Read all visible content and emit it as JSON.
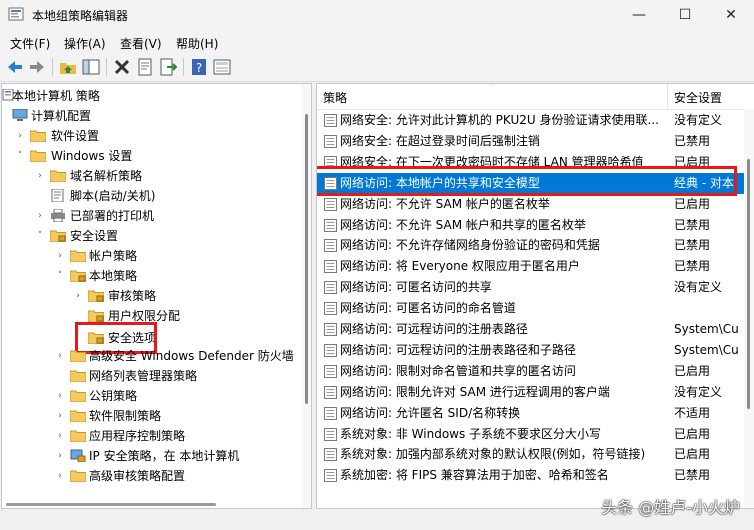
{
  "window": {
    "title": "本地组策略编辑器",
    "controls": {
      "minimize": "—",
      "maximize": "☐",
      "close": "✕"
    }
  },
  "menu": [
    "文件(F)",
    "操作(A)",
    "查看(V)",
    "帮助(H)"
  ],
  "toolbar": {
    "icons": [
      "back-icon",
      "forward-icon",
      "up-folder-icon",
      "show-hide-tree-icon",
      "delete-icon",
      "properties-icon",
      "export-list-icon",
      "help-icon",
      "view-icon"
    ]
  },
  "tree": {
    "root": "本地计算机 策略",
    "items": [
      {
        "label": "计算机配置",
        "expander": ""
      },
      {
        "label": "软件设置",
        "expander": "›"
      },
      {
        "label": "Windows 设置",
        "expander": "˅"
      },
      {
        "label": "域名解析策略",
        "expander": "›"
      },
      {
        "label": "脚本(启动/关机)",
        "expander": ""
      },
      {
        "label": "已部署的打印机",
        "expander": "›"
      },
      {
        "label": "安全设置",
        "expander": "˅"
      },
      {
        "label": "帐户策略",
        "expander": "›"
      },
      {
        "label": "本地策略",
        "expander": "˅"
      },
      {
        "label": "审核策略",
        "expander": "›"
      },
      {
        "label": "用户权限分配",
        "expander": ""
      },
      {
        "label": "安全选项",
        "expander": ""
      },
      {
        "label": "高级安全 Windows Defender 防火墙",
        "expander": "›"
      },
      {
        "label": "网络列表管理器策略",
        "expander": ""
      },
      {
        "label": "公钥策略",
        "expander": "›"
      },
      {
        "label": "软件限制策略",
        "expander": "›"
      },
      {
        "label": "应用程序控制策略",
        "expander": "›"
      },
      {
        "label": "IP 安全策略，在 本地计算机",
        "expander": "›"
      },
      {
        "label": "高级审核策略配置",
        "expander": "›"
      }
    ]
  },
  "list": {
    "columns": {
      "policy": "策略",
      "setting": "安全设置"
    },
    "rows": [
      {
        "name": "网络安全: 允许对此计算机的 PKU2U 身份验证请求使用联...",
        "setting": "没有定义"
      },
      {
        "name": "网络安全: 在超过登录时间后强制注销",
        "setting": "已禁用"
      },
      {
        "name": "网络安全: 在下一次更改密码时不存储 LAN 管理器哈希值",
        "setting": "已启用"
      },
      {
        "name": "网络访问: 本地帐户的共享和安全模型",
        "setting": "经典 - 对本"
      },
      {
        "name": "网络访问: 不允许 SAM 帐户的匿名枚举",
        "setting": "已启用"
      },
      {
        "name": "网络访问: 不允许 SAM 帐户和共享的匿名枚举",
        "setting": "已禁用"
      },
      {
        "name": "网络访问: 不允许存储网络身份验证的密码和凭据",
        "setting": "已禁用"
      },
      {
        "name": "网络访问: 将 Everyone 权限应用于匿名用户",
        "setting": "已禁用"
      },
      {
        "name": "网络访问: 可匿名访问的共享",
        "setting": "没有定义"
      },
      {
        "name": "网络访问: 可匿名访问的命名管道",
        "setting": ""
      },
      {
        "name": "网络访问: 可远程访问的注册表路径",
        "setting": "System\\Cu"
      },
      {
        "name": "网络访问: 可远程访问的注册表路径和子路径",
        "setting": "System\\Cu"
      },
      {
        "name": "网络访问: 限制对命名管道和共享的匿名访问",
        "setting": "已启用"
      },
      {
        "name": "网络访问: 限制允许对 SAM 进行远程调用的客户端",
        "setting": "没有定义"
      },
      {
        "name": "网络访问: 允许匿名 SID/名称转换",
        "setting": "不适用"
      },
      {
        "name": "系统对象: 非 Windows 子系统不要求区分大小写",
        "setting": "已启用"
      },
      {
        "name": "系统对象: 加强内部系统对象的默认权限(例如，符号链接)",
        "setting": "已启用"
      },
      {
        "name": "系统加密: 将 FIPS 兼容算法用于加密、哈希和签名",
        "setting": "已禁用"
      }
    ],
    "selected_index": 3
  },
  "watermark": "头条 @姓卢-小火炉",
  "colors": {
    "selection": "#0078d7",
    "highlight_box": "#e81919",
    "folder": "#f4c95d"
  }
}
